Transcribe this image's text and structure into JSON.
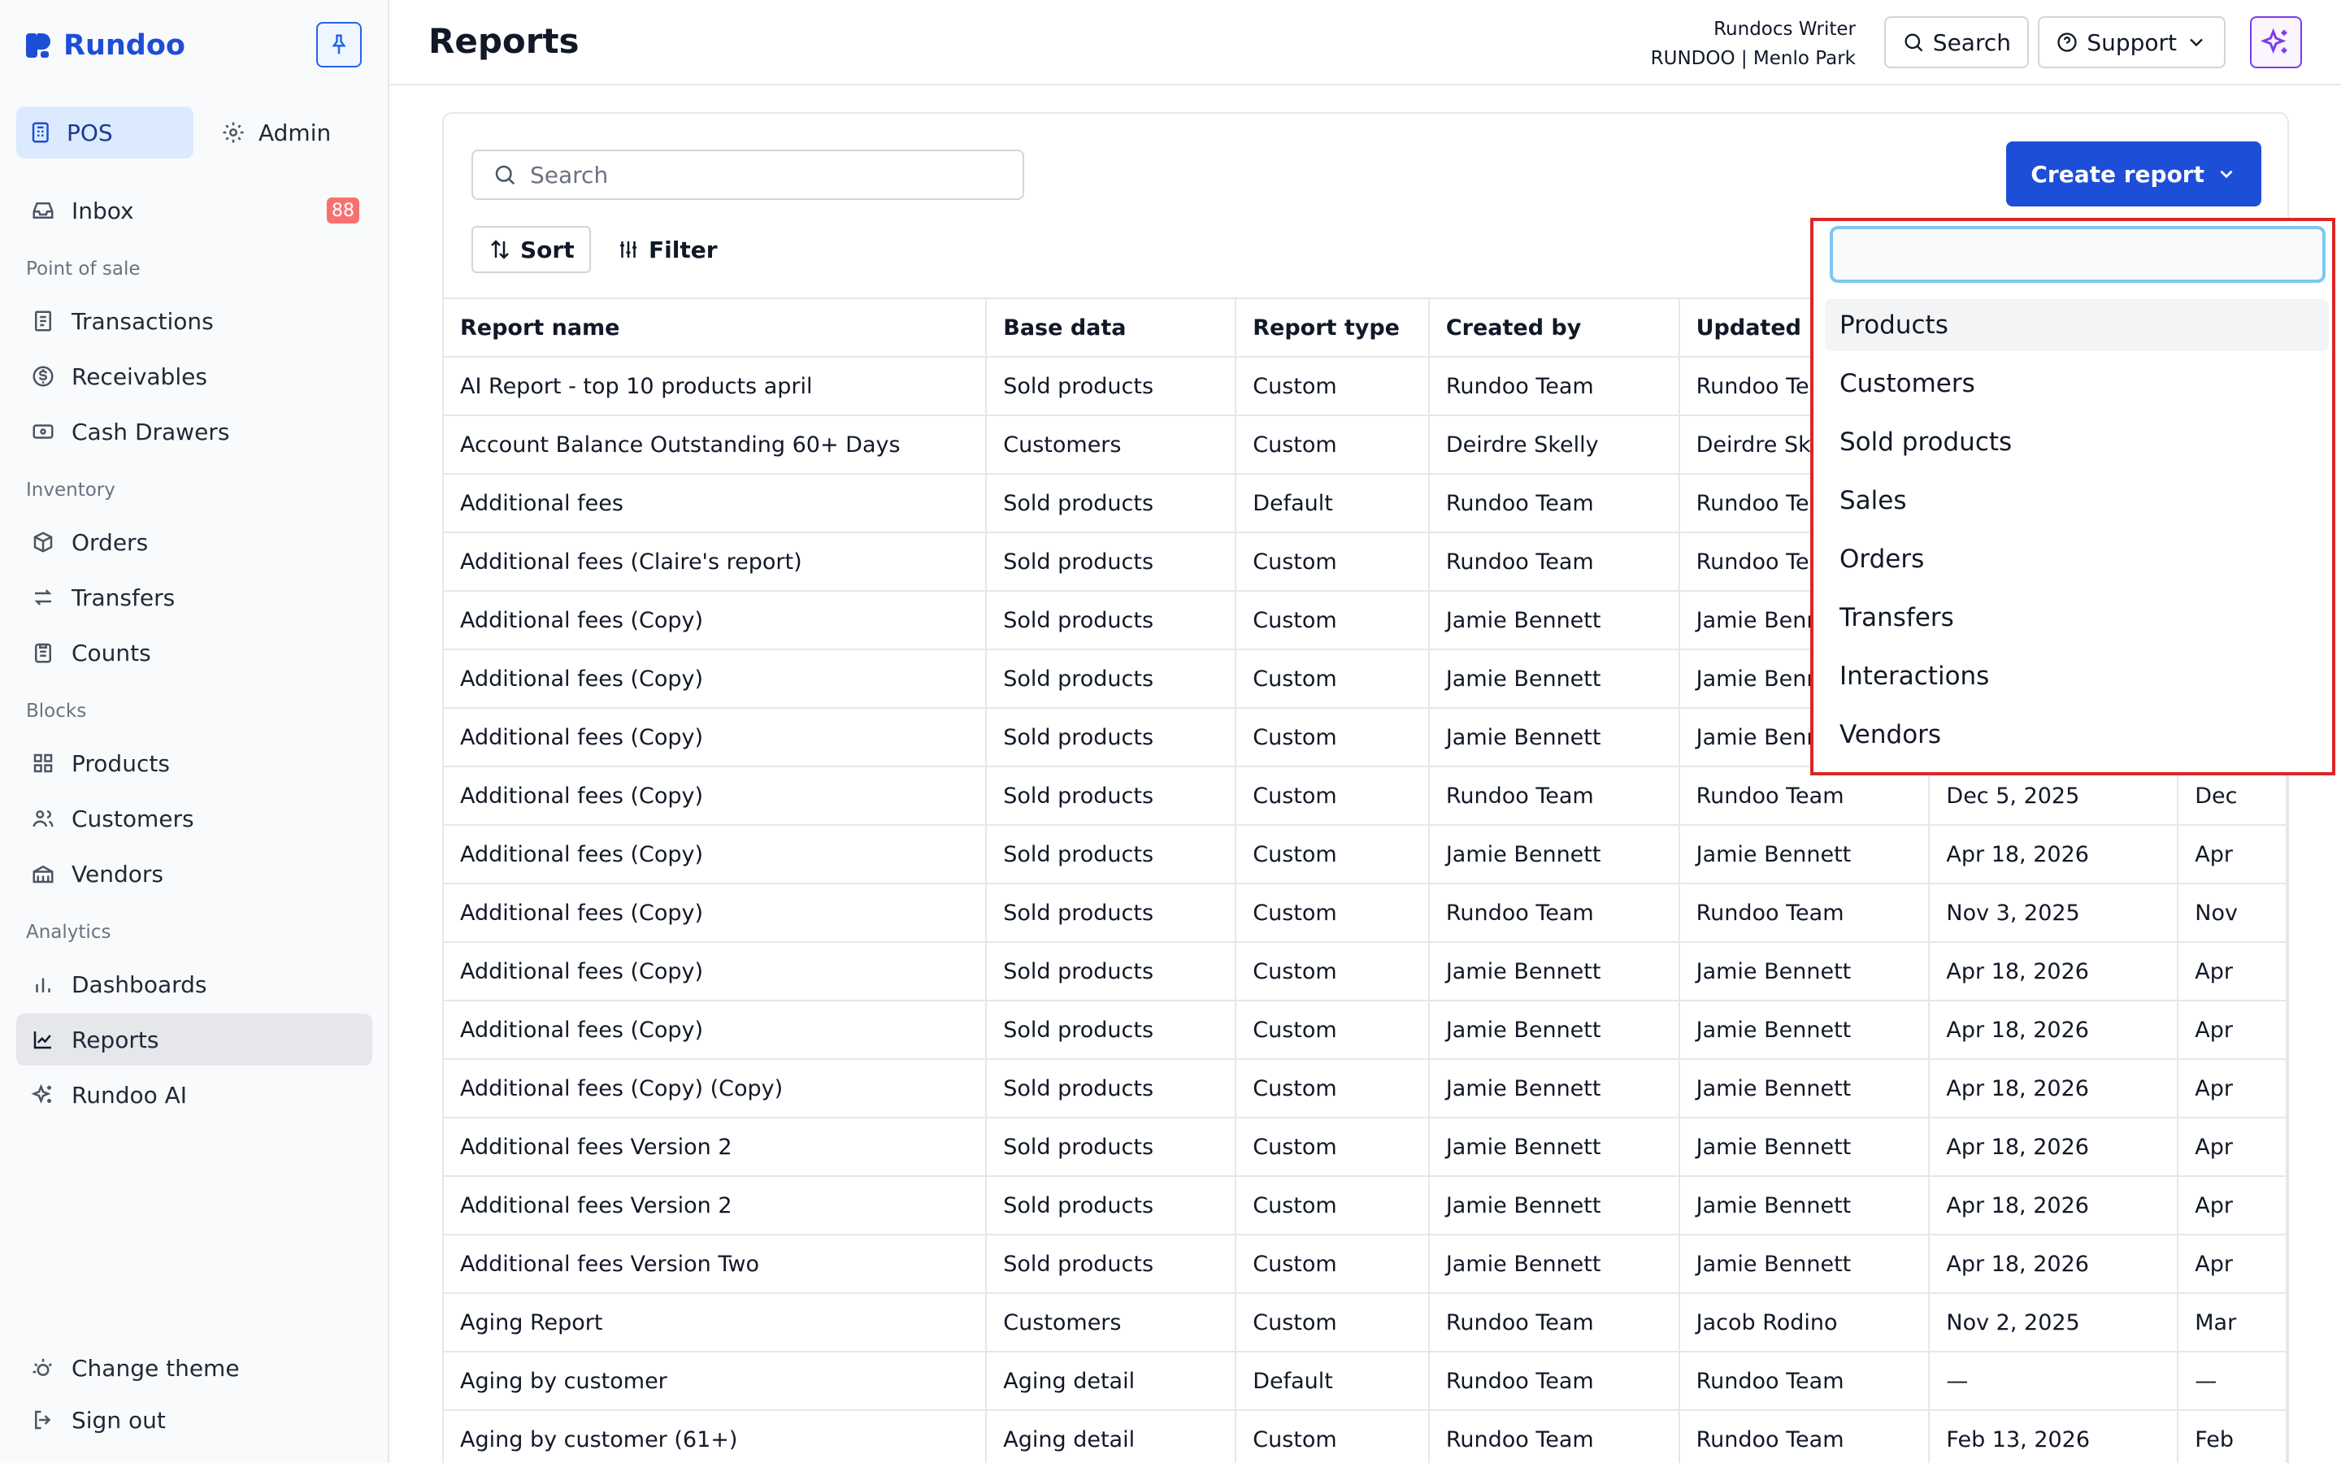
{
  "app": {
    "name": "Rundoo"
  },
  "sidebar": {
    "modes": [
      {
        "label": "POS",
        "active": true
      },
      {
        "label": "Admin",
        "active": false
      }
    ],
    "inbox": {
      "label": "Inbox",
      "badge": "88"
    },
    "sections": {
      "point_of_sale": "Point of sale",
      "inventory": "Inventory",
      "blocks": "Blocks",
      "analytics": "Analytics"
    },
    "items": {
      "transactions": "Transactions",
      "receivables": "Receivables",
      "cash_drawers": "Cash Drawers",
      "orders": "Orders",
      "transfers": "Transfers",
      "counts": "Counts",
      "products": "Products",
      "customers": "Customers",
      "vendors": "Vendors",
      "dashboards": "Dashboards",
      "reports": "Reports",
      "rundoo_ai": "Rundoo AI"
    },
    "footer": {
      "change_theme": "Change theme",
      "sign_out": "Sign out"
    }
  },
  "header": {
    "title": "Reports",
    "user_name": "Rundocs Writer",
    "user_org": "RUNDOO | Menlo Park",
    "search_label": "Search",
    "support_label": "Support"
  },
  "toolbar": {
    "search_placeholder": "Search",
    "sort_label": "Sort",
    "filter_label": "Filter",
    "create_label": "Create report"
  },
  "table": {
    "columns": [
      "Report name",
      "Base data",
      "Report type",
      "Created by",
      "Updated by",
      "",
      ""
    ],
    "rows": [
      [
        "AI Report - top 10 products april",
        "Sold products",
        "Custom",
        "Rundoo Team",
        "Rundoo Team",
        "",
        ""
      ],
      [
        "Account Balance Outstanding 60+ Days",
        "Customers",
        "Custom",
        "Deirdre Skelly",
        "Deirdre Skelly",
        "",
        ""
      ],
      [
        "Additional fees",
        "Sold products",
        "Default",
        "Rundoo Team",
        "Rundoo Team",
        "",
        ""
      ],
      [
        "Additional fees (Claire's report)",
        "Sold products",
        "Custom",
        "Rundoo Team",
        "Rundoo Team",
        "",
        ""
      ],
      [
        "Additional fees (Copy)",
        "Sold products",
        "Custom",
        "Jamie Bennett",
        "Jamie Bennett",
        "",
        ""
      ],
      [
        "Additional fees (Copy)",
        "Sold products",
        "Custom",
        "Jamie Bennett",
        "Jamie Bennett",
        "",
        ""
      ],
      [
        "Additional fees (Copy)",
        "Sold products",
        "Custom",
        "Jamie Bennett",
        "Jamie Bennett",
        "",
        ""
      ],
      [
        "Additional fees (Copy)",
        "Sold products",
        "Custom",
        "Rundoo Team",
        "Rundoo Team",
        "Dec 5, 2025",
        "Dec"
      ],
      [
        "Additional fees (Copy)",
        "Sold products",
        "Custom",
        "Jamie Bennett",
        "Jamie Bennett",
        "Apr 18, 2026",
        "Apr"
      ],
      [
        "Additional fees (Copy)",
        "Sold products",
        "Custom",
        "Rundoo Team",
        "Rundoo Team",
        "Nov 3, 2025",
        "Nov"
      ],
      [
        "Additional fees (Copy)",
        "Sold products",
        "Custom",
        "Jamie Bennett",
        "Jamie Bennett",
        "Apr 18, 2026",
        "Apr"
      ],
      [
        "Additional fees (Copy)",
        "Sold products",
        "Custom",
        "Jamie Bennett",
        "Jamie Bennett",
        "Apr 18, 2026",
        "Apr"
      ],
      [
        "Additional fees (Copy) (Copy)",
        "Sold products",
        "Custom",
        "Jamie Bennett",
        "Jamie Bennett",
        "Apr 18, 2026",
        "Apr"
      ],
      [
        "Additional fees Version 2",
        "Sold products",
        "Custom",
        "Jamie Bennett",
        "Jamie Bennett",
        "Apr 18, 2026",
        "Apr"
      ],
      [
        "Additional fees Version 2",
        "Sold products",
        "Custom",
        "Jamie Bennett",
        "Jamie Bennett",
        "Apr 18, 2026",
        "Apr"
      ],
      [
        "Additional fees Version Two",
        "Sold products",
        "Custom",
        "Jamie Bennett",
        "Jamie Bennett",
        "Apr 18, 2026",
        "Apr"
      ],
      [
        "Aging Report",
        "Customers",
        "Custom",
        "Rundoo Team",
        "Jacob Rodino",
        "Nov 2, 2025",
        "Mar"
      ],
      [
        "Aging by customer",
        "Aging detail",
        "Default",
        "Rundoo Team",
        "Rundoo Team",
        "—",
        "—"
      ],
      [
        "Aging by customer (61+)",
        "Aging detail",
        "Custom",
        "Rundoo Team",
        "Rundoo Team",
        "Feb 13, 2026",
        "Feb"
      ]
    ]
  },
  "dropdown": {
    "input_value": "",
    "options": [
      "Products",
      "Customers",
      "Sold products",
      "Sales",
      "Orders",
      "Transfers",
      "Interactions",
      "Vendors"
    ],
    "hovered_index": 0
  },
  "colors": {
    "accent": "#1d4ed8",
    "highlight_border": "#dc2626",
    "badge": "#f87171"
  }
}
